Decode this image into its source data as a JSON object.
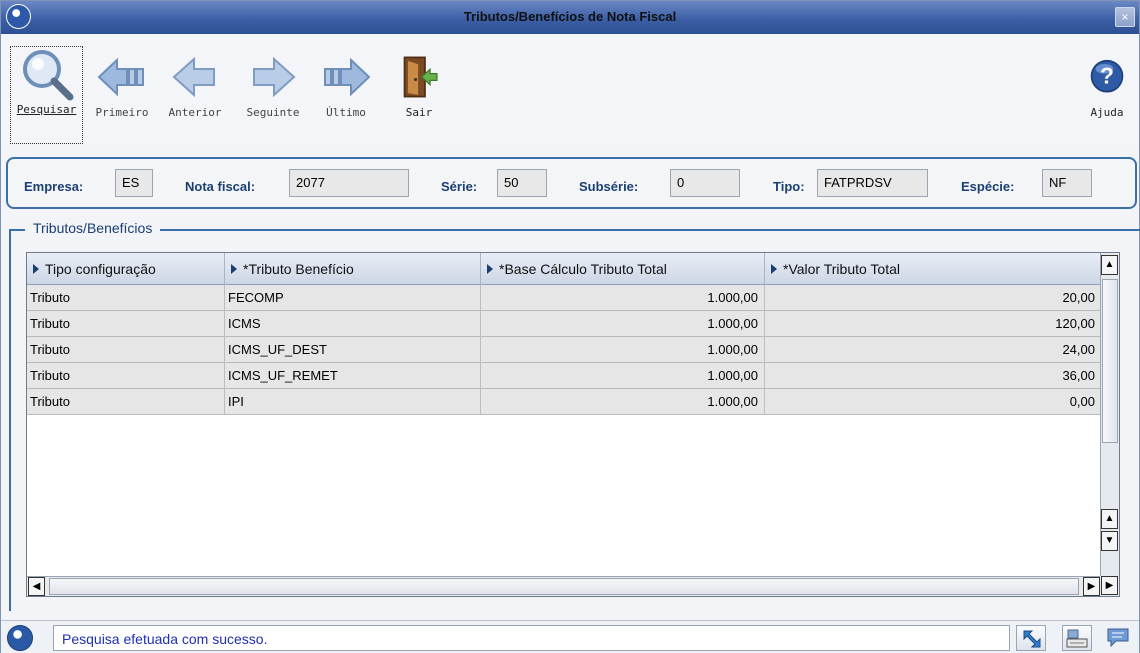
{
  "window": {
    "title": "Tributos/Benefícios de Nota Fiscal",
    "close_glyph": "×"
  },
  "toolbar": {
    "items": [
      {
        "label": "Pesquisar",
        "icon": "magnifier-icon"
      },
      {
        "label": "Primeiro",
        "icon": "first-arrow-icon"
      },
      {
        "label": "Anterior",
        "icon": "previous-arrow-icon"
      },
      {
        "label": "Seguinte",
        "icon": "next-arrow-icon"
      },
      {
        "label": "Último",
        "icon": "last-arrow-icon"
      },
      {
        "label": "Sair",
        "icon": "exit-door-icon"
      },
      {
        "label": "Ajuda",
        "icon": "help-icon"
      }
    ],
    "help_glyph": "?"
  },
  "header": {
    "empresa_label": "Empresa:",
    "empresa_value": "ES",
    "nota_label": "Nota fiscal:",
    "nota_value": "2077",
    "serie_label": "Série:",
    "serie_value": "50",
    "subserie_label": "Subsérie:",
    "subserie_value": "0",
    "tipo_label": "Tipo:",
    "tipo_value": "FATPRDSV",
    "especie_label": "Espécie:",
    "especie_value": "NF"
  },
  "group": {
    "title": "Tributos/Benefícios"
  },
  "grid": {
    "columns": [
      "Tipo configuração",
      "*Tributo Benefício",
      "*Base Cálculo Tributo Total",
      "*Valor Tributo Total"
    ],
    "rows": [
      [
        "Tributo",
        "FECOMP",
        "1.000,00",
        "20,00"
      ],
      [
        "Tributo",
        "ICMS",
        "1.000,00",
        "120,00"
      ],
      [
        "Tributo",
        "ICMS_UF_DEST",
        "1.000,00",
        "24,00"
      ],
      [
        "Tributo",
        "ICMS_UF_REMET",
        "1.000,00",
        "36,00"
      ],
      [
        "Tributo",
        "IPI",
        "1.000,00",
        "0,00"
      ]
    ],
    "scroll_up": "▲",
    "scroll_down": "▼",
    "scroll_left": "◀",
    "scroll_right": "▶"
  },
  "statusbar": {
    "message": "Pesquisa efetuada com sucesso."
  },
  "colors": {
    "accent": "#3a6fa8",
    "title_bar": "#3c5fa6",
    "status_text": "#1f2fb0"
  }
}
